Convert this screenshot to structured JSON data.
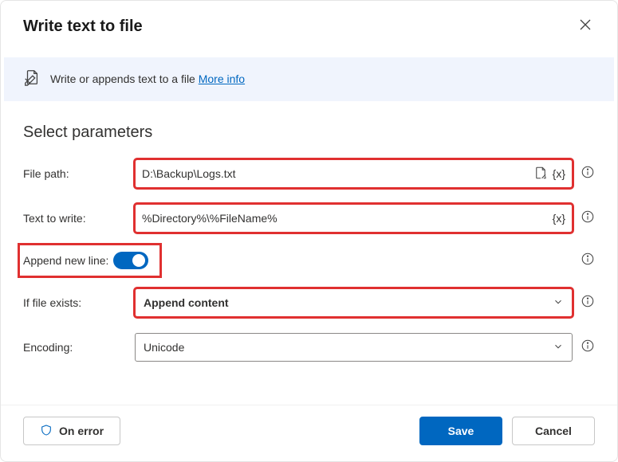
{
  "header": {
    "title": "Write text to file"
  },
  "banner": {
    "text": "Write or appends text to a file ",
    "link_label": "More info"
  },
  "section_title": "Select parameters",
  "fields": {
    "file_path": {
      "label": "File path:",
      "value": "D:\\Backup\\Logs.txt"
    },
    "text_to_write": {
      "label": "Text to write:",
      "value": "%Directory%\\%FileName%"
    },
    "append_new_line": {
      "label": "Append new line:",
      "value": true
    },
    "if_file_exists": {
      "label": "If file exists:",
      "value": "Append content"
    },
    "encoding": {
      "label": "Encoding:",
      "value": "Unicode"
    }
  },
  "footer": {
    "on_error": "On error",
    "save": "Save",
    "cancel": "Cancel"
  }
}
